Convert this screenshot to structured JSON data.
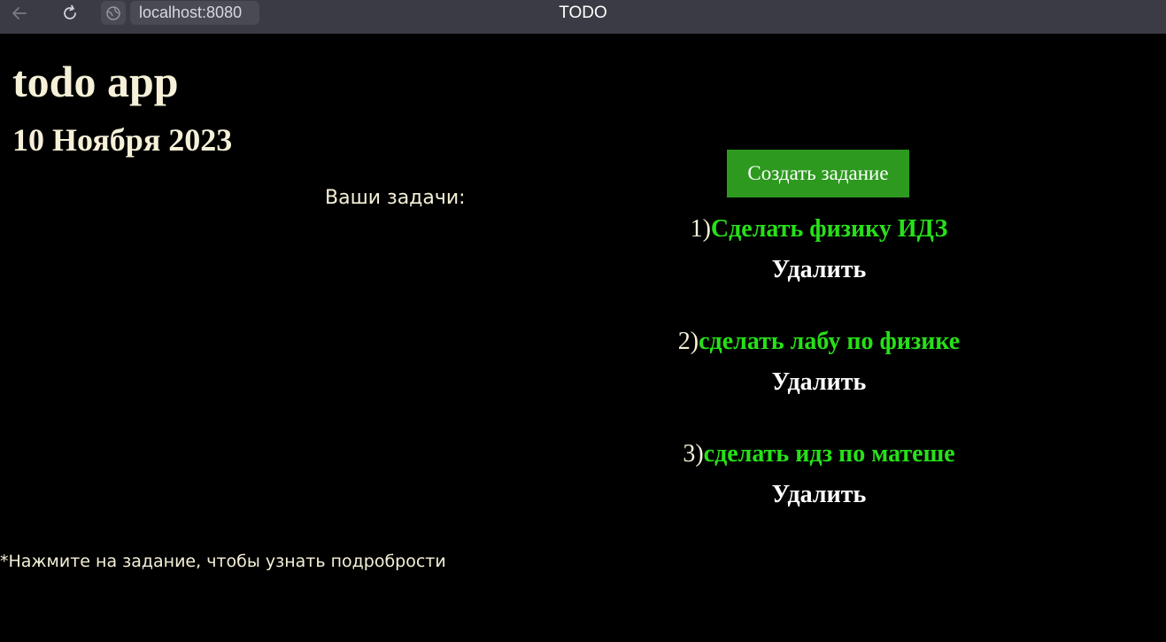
{
  "browser": {
    "url": "localhost:8080",
    "tab_title": "TODO",
    "icons": {
      "back": "arrow-left-icon",
      "reload": "reload-icon",
      "site_info": "globe-icon"
    }
  },
  "page": {
    "app_title": "todo app",
    "date": "10 Ноября 2023",
    "tasks_label": "Ваши задачи:",
    "create_button_label": "Создать задание",
    "footnote": "*Нажмите на задание, чтобы узнать подробрости",
    "colors": {
      "background": "#000000",
      "heading_text": "#f5f0d7",
      "task_link": "#27e018",
      "create_button_bg": "#2d9a1f",
      "delete_text": "#ffffff"
    }
  },
  "tasks": [
    {
      "number": "1)",
      "title": "Сделать физику ИДЗ",
      "delete_label": "Удалить"
    },
    {
      "number": "2)",
      "title": "сделать лабу по физике",
      "delete_label": "Удалить"
    },
    {
      "number": "3)",
      "title": "сделать идз по матеше",
      "delete_label": "Удалить"
    }
  ]
}
